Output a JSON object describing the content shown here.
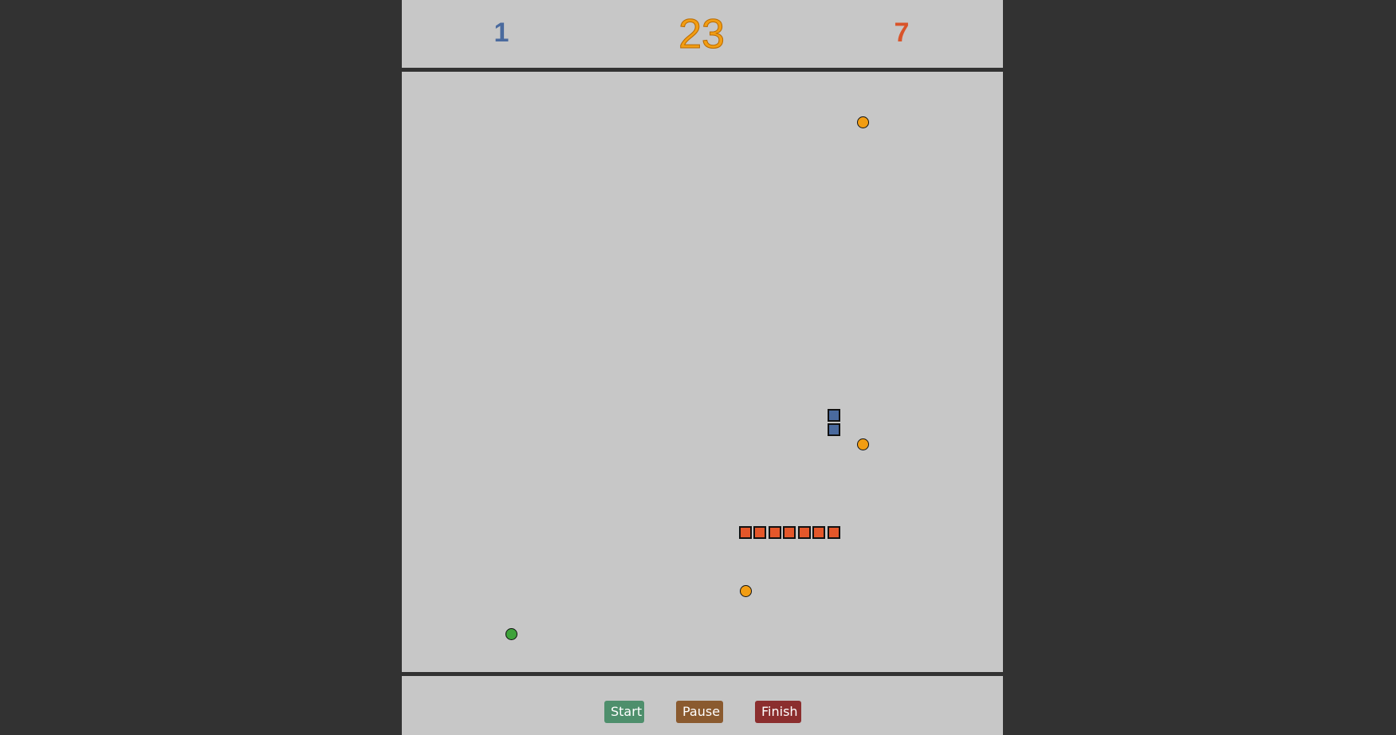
{
  "scoreboard": {
    "left_score": "1",
    "center_score": "23",
    "right_score": "7"
  },
  "colors": {
    "background": "#323232",
    "board": "#c7c7c7",
    "blue_snake": "#4a6a9e",
    "red_snake": "#e4572a",
    "orange_food": "#f29d12",
    "green_food": "#3ea23a"
  },
  "board": {
    "foods": [
      {
        "kind": "orange",
        "icon": "orange-food-icon"
      },
      {
        "kind": "orange",
        "icon": "orange-food-icon"
      },
      {
        "kind": "orange",
        "icon": "orange-food-icon"
      },
      {
        "kind": "green",
        "icon": "green-food-icon"
      }
    ],
    "snakes": [
      {
        "color": "blue",
        "segments": 2
      },
      {
        "color": "red",
        "segments": 7
      }
    ]
  },
  "controls": {
    "start_label": "Start",
    "pause_label": "Pause",
    "finish_label": "Finish"
  }
}
